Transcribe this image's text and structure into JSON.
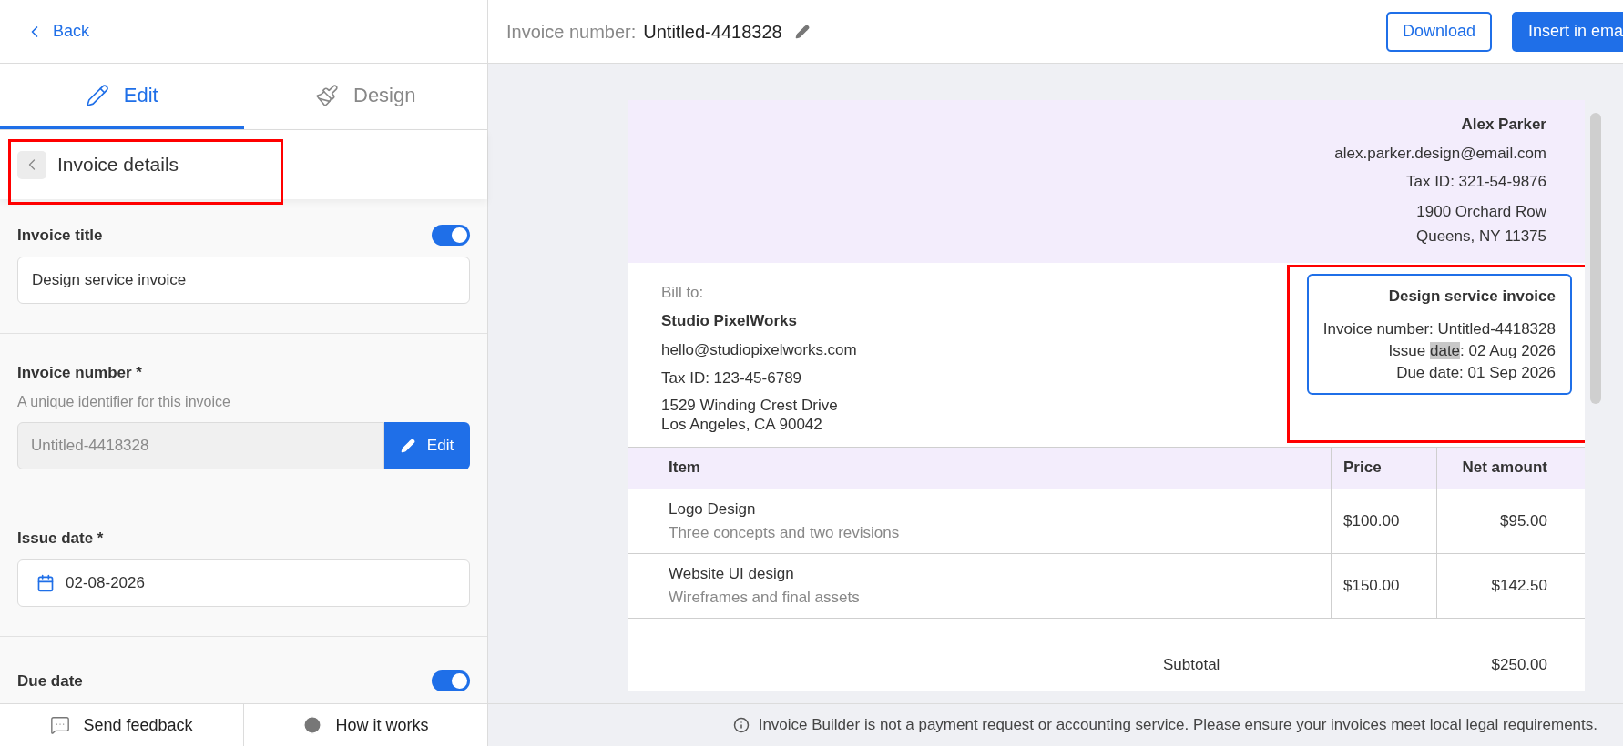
{
  "back": {
    "label": "Back"
  },
  "tabs": [
    {
      "label": "Edit",
      "selected": true
    },
    {
      "label": "Design",
      "selected": false
    }
  ],
  "section": {
    "title": "Invoice details",
    "highlighted": true
  },
  "fields": [
    {
      "kind": "text",
      "label": "Invoice title",
      "toggle": true,
      "value": "Design service invoice"
    },
    {
      "kind": "locked",
      "label": "Invoice number *",
      "hint": "A unique identifier for this invoice",
      "value": "Untitled-4418328",
      "button": "Edit"
    },
    {
      "kind": "date",
      "label": "Issue date *",
      "value": "02-08-2026"
    },
    {
      "kind": "cut",
      "label": "Due date",
      "toggle": true
    }
  ],
  "footer_buttons": [
    {
      "label": "Send feedback"
    },
    {
      "label": "How it works"
    }
  ],
  "header": {
    "label": "Invoice number:",
    "value": "Untitled-4418328",
    "buttons": [
      {
        "label": "Download",
        "kind": "outline"
      },
      {
        "label": "Insert in ema",
        "kind": "primary"
      }
    ]
  },
  "invoice": {
    "sender": {
      "name": "Alex Parker",
      "lines": [
        "alex.parker.design@email.com",
        "Tax ID: 321-54-9876"
      ],
      "address": [
        "1900 Orchard Row",
        "Queens, NY 11375"
      ]
    },
    "bill_to": {
      "label": "Bill to:",
      "name": "Studio PixelWorks",
      "lines": [
        "hello@studiopixelworks.com",
        "Tax ID: 123-45-6789"
      ],
      "address": [
        "1529 Winding Crest Drive",
        "Los Angeles, CA 90042"
      ]
    },
    "meta": {
      "title": "Design service invoice",
      "highlighted": true,
      "lines": [
        {
          "parts": [
            {
              "text": "Invoice number: Untitled-4418328",
              "selected": false
            }
          ]
        },
        {
          "parts": [
            {
              "text": "Issue ",
              "selected": false
            },
            {
              "text": "date",
              "selected": true
            },
            {
              "text": ": 02 Aug 2026",
              "selected": false
            }
          ]
        },
        {
          "parts": [
            {
              "text": "Due date: 01 Sep 2026",
              "selected": false
            }
          ]
        }
      ]
    },
    "columns": [
      "Item",
      "Price",
      "Net amount"
    ],
    "rows": [
      {
        "item": "Logo Design",
        "description": "Three concepts and two revisions",
        "price": "$100.00",
        "net": "$95.00"
      },
      {
        "item": "Website UI design",
        "description": "Wireframes and final assets",
        "price": "$150.00",
        "net": "$142.50"
      }
    ],
    "subtotal": {
      "label": "Subtotal",
      "value": "$250.00"
    }
  },
  "notice": "Invoice Builder is not a payment request or accounting service. Please ensure your invoices meet local legal requirements."
}
